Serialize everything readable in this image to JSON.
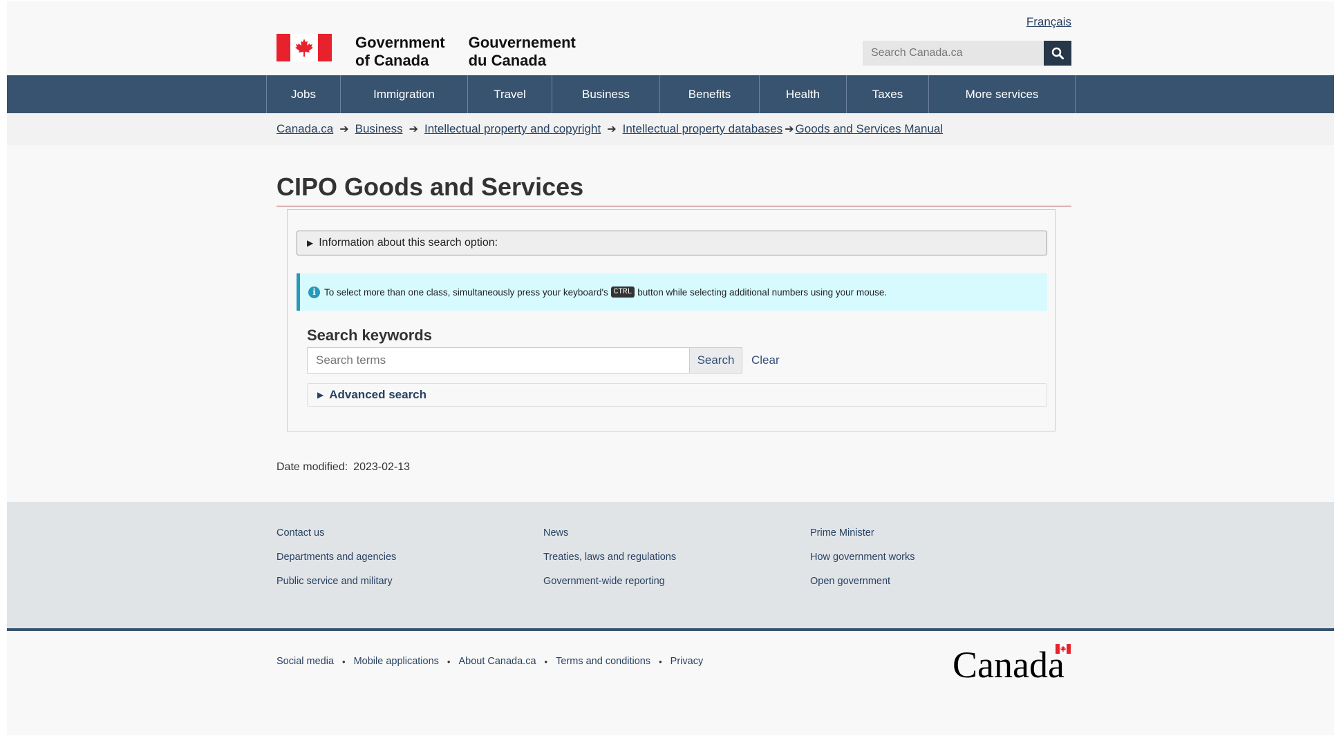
{
  "header": {
    "lang_toggle": "Français",
    "signature_en": "Government\nof Canada",
    "signature_fr": "Gouvernement\ndu Canada",
    "search_placeholder": "Search Canada.ca",
    "icons": {
      "flag": "canada-flag-icon",
      "search": "search-icon"
    },
    "colors": {
      "nav_bg": "#38536f",
      "flag_red": "#e8222c"
    }
  },
  "nav": {
    "items": [
      {
        "label": "Jobs",
        "w": 107
      },
      {
        "label": "Immigration",
        "w": 184
      },
      {
        "label": "Travel",
        "w": 122
      },
      {
        "label": "Business",
        "w": 156
      },
      {
        "label": "Benefits",
        "w": 144
      },
      {
        "label": "Health",
        "w": 126
      },
      {
        "label": "Taxes",
        "w": 119
      },
      {
        "label": "More services",
        "w": 212
      }
    ]
  },
  "breadcrumb": {
    "items": [
      "Canada.ca",
      "Business",
      "Intellectual property and copyright",
      "Intellectual property databases",
      "Goods and Services Manual"
    ]
  },
  "main": {
    "title": "CIPO Goods and Services",
    "info_toggle": "Information about this search option:",
    "alert": {
      "before": "To select more than one class, simultaneously press your keyboard's",
      "key": "CTRL",
      "after": "button while selecting additional numbers using your mouse."
    },
    "search": {
      "label": "Search keywords",
      "placeholder": "Search terms",
      "button": "Search",
      "clear": "Clear"
    },
    "advanced": "Advanced search",
    "date_label": "Date modified:",
    "date_value": "2023-02-13"
  },
  "footer": {
    "columns": [
      [
        "Contact us",
        "Departments and agencies",
        "Public service and military"
      ],
      [
        "News",
        "Treaties, laws and regulations",
        "Government-wide reporting"
      ],
      [
        "Prime Minister",
        "How government works",
        "Open government"
      ]
    ],
    "sub_links": [
      "Social media",
      "Mobile applications",
      "About Canada.ca",
      "Terms and conditions",
      "Privacy"
    ],
    "wordmark": "Canada"
  }
}
